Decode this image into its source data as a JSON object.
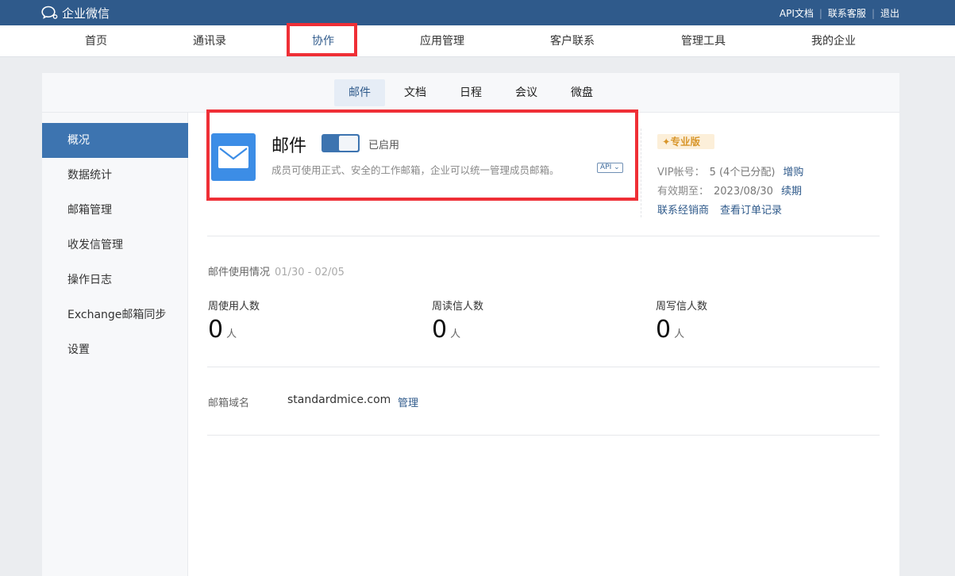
{
  "app": {
    "name": "企业微信"
  },
  "toplinks": {
    "api_docs": "API文档",
    "support": "联系客服",
    "logout": "退出"
  },
  "nav": {
    "home": "首页",
    "contacts": "通讯录",
    "collab": "协作",
    "apps": "应用管理",
    "customer": "客户联系",
    "tools": "管理工具",
    "company": "我的企业"
  },
  "subnav": {
    "mail": "邮件",
    "docs": "文档",
    "schedule": "日程",
    "meeting": "会议",
    "disk": "微盘"
  },
  "sidebar": {
    "overview": "概况",
    "stats": "数据统计",
    "mailbox": "邮箱管理",
    "send_receive": "收发信管理",
    "log": "操作日志",
    "exchange": "Exchange邮箱同步",
    "settings": "设置"
  },
  "mail": {
    "title": "邮件",
    "status": "已启用",
    "description": "成员可使用正式、安全的工作邮箱，企业可以统一管理成员邮箱。",
    "api_tag": "API ⌄"
  },
  "vip": {
    "badge": "专业版",
    "account_label": "VIP帐号：",
    "account_value": "5 (4个已分配)",
    "buy_more": "增购",
    "valid_label": "有效期至：",
    "valid_value": "2023/08/30",
    "renew": "续期",
    "contact_dealer": "联系经销商",
    "order_records": "查看订单记录"
  },
  "usage": {
    "title": "邮件使用情况",
    "range": "01/30 - 02/05",
    "weekly_users_label": "周使用人数",
    "weekly_users_value": "0",
    "weekly_readers_label": "周读信人数",
    "weekly_readers_value": "0",
    "weekly_writers_label": "周写信人数",
    "weekly_writers_value": "0",
    "unit": "人"
  },
  "domain": {
    "label": "邮箱域名",
    "value": "standardmice.com",
    "manage": "管理"
  },
  "colors": {
    "topbar": "#2f5a8b",
    "accent": "#3d74b0",
    "mail_icon": "#3c8de6",
    "highlight": "#ef2f36",
    "badge_text": "#d8962a"
  }
}
